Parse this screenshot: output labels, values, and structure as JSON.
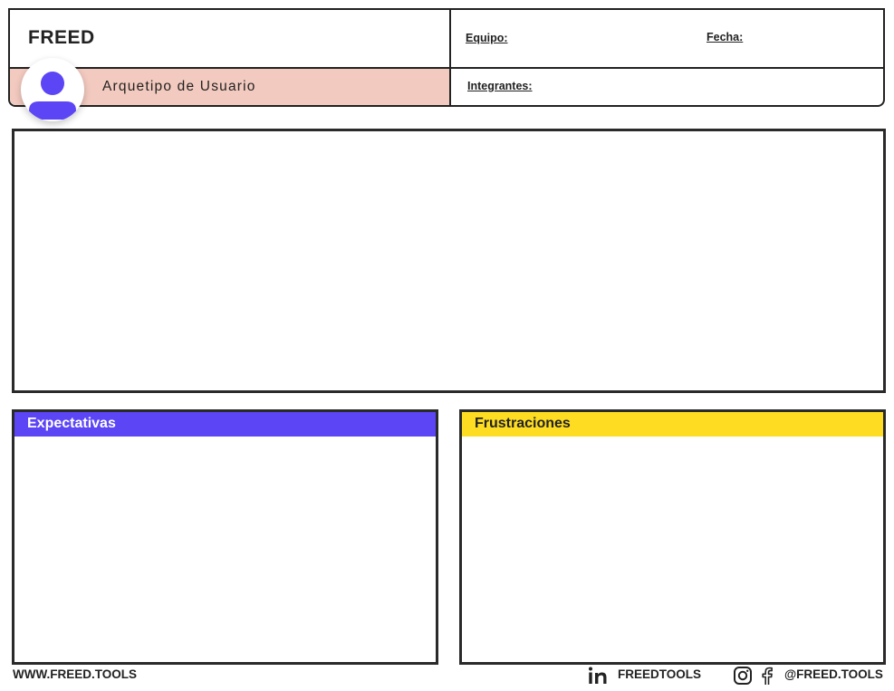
{
  "header": {
    "brand": "FREED",
    "archetype_label": "Arquetipo de Usuario",
    "team_label": "Equipo:",
    "date_label": "Fecha:",
    "members_label": "Integrantes:",
    "archetype_color": "#f3cabf",
    "avatar_color": "#5b45f5"
  },
  "panels": {
    "expectations": {
      "title": "Expectativas",
      "color": "#5b45f5",
      "text_color": "#ffffff"
    },
    "frustrations": {
      "title": "Frustraciones",
      "color": "#fddc22",
      "text_color": "#222222"
    }
  },
  "footer": {
    "website": "WWW.FREED.TOOLS",
    "linkedin_handle": "FREEDTOOLS",
    "social_handle": "@FREED.TOOLS",
    "icons": [
      "linkedin-icon",
      "instagram-icon",
      "facebook-icon"
    ]
  }
}
